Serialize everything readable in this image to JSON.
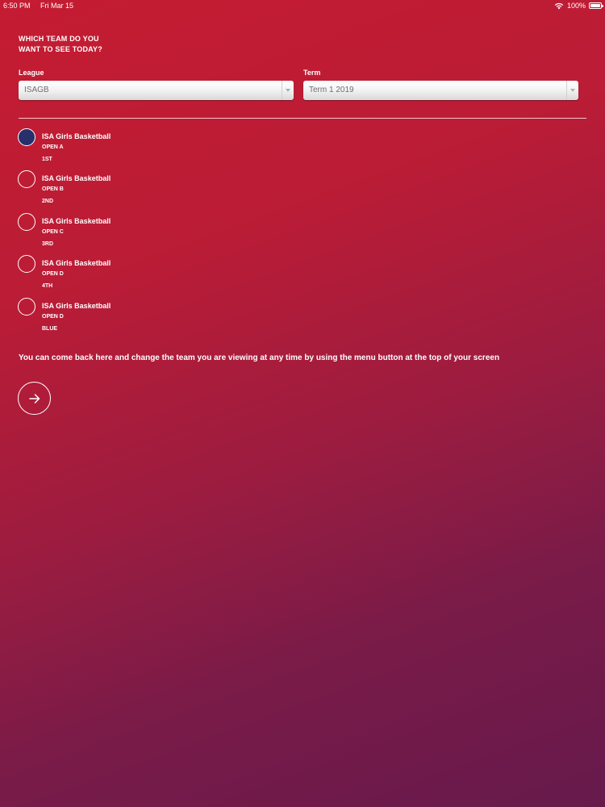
{
  "status_bar": {
    "time": "6:50 PM",
    "date": "Fri Mar 15",
    "battery": "100%"
  },
  "title": {
    "line1": "WHICH TEAM DO YOU",
    "line2": "WANT TO SEE TODAY?"
  },
  "league": {
    "label": "League",
    "value": "ISAGB"
  },
  "term": {
    "label": "Term",
    "value": "Term 1 2019"
  },
  "teams": [
    {
      "name": "ISA Girls Basketball",
      "division": "OPEN A",
      "rank": "1ST",
      "selected": true
    },
    {
      "name": "ISA Girls Basketball",
      "division": "OPEN B",
      "rank": "2ND",
      "selected": false
    },
    {
      "name": "ISA Girls Basketball",
      "division": "OPEN C",
      "rank": "3RD",
      "selected": false
    },
    {
      "name": "ISA Girls Basketball",
      "division": "OPEN D",
      "rank": "4TH",
      "selected": false
    },
    {
      "name": "ISA Girls Basketball",
      "division": "OPEN D",
      "rank": "BLUE",
      "selected": false
    }
  ],
  "info_text": "You can come back here and change the team you are viewing at any time by using the menu button at the top of your screen",
  "icons": {
    "next": "arrow-right-icon",
    "wifi": "wifi-icon",
    "battery": "battery-icon",
    "dropdown": "chevron-down-icon"
  },
  "colors": {
    "selected_radio": "#27306a",
    "background_top": "#c41c32",
    "background_bottom": "#661a4c"
  }
}
